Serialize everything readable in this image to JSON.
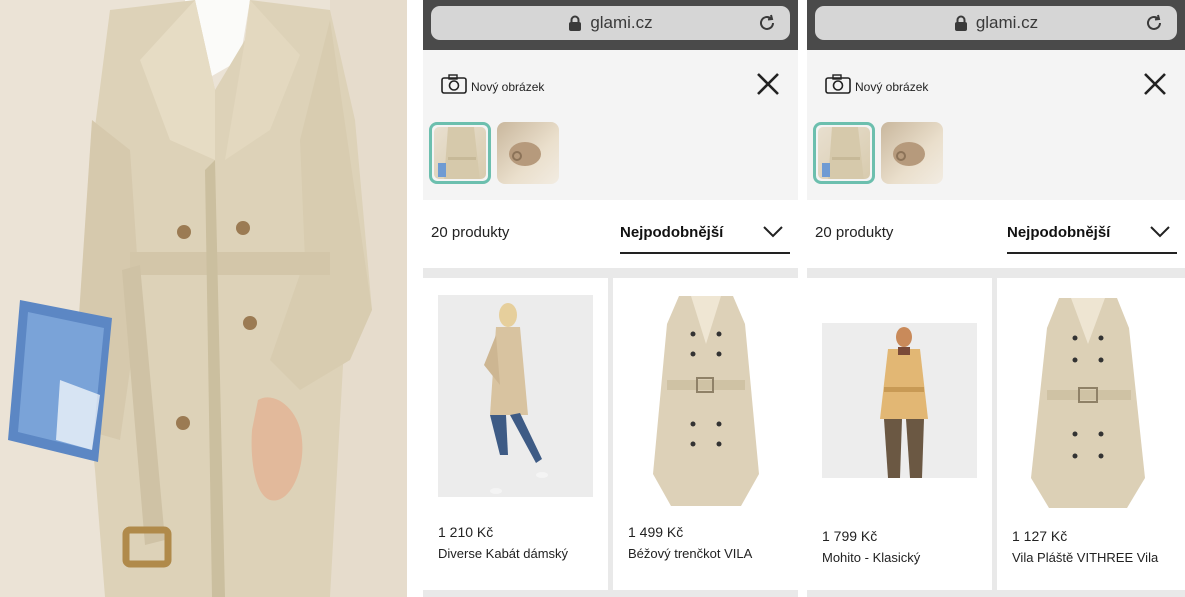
{
  "browser": {
    "url": "glami.cz"
  },
  "panel_left": {
    "new_image_label": "Nový obrázek",
    "product_count": "20 produkty",
    "sort_label": "Nejpodobnější",
    "products": [
      {
        "price": "1 210 Kč",
        "name": "Diverse Kabát dámský"
      },
      {
        "price": "1 499 Kč",
        "name": "Béžový trenčkot VILA"
      }
    ]
  },
  "panel_right": {
    "new_image_label": "Nový obrázek",
    "product_count": "20 produkty",
    "sort_label": "Nejpodobnější",
    "products": [
      {
        "price": "1 799 Kč",
        "name": "Mohito - Klasický"
      },
      {
        "price": "1 127 Kč",
        "name": "Vila Pláště VITHREE Vila"
      }
    ]
  },
  "colors": {
    "accent_selected_thumb": "#6cbfae",
    "url_bar": "#4a4a4a",
    "trench_beige": "#dcd0b6"
  },
  "icons": [
    "lock-icon",
    "reload-icon",
    "camera-icon",
    "close-icon",
    "chevron-down-icon"
  ]
}
